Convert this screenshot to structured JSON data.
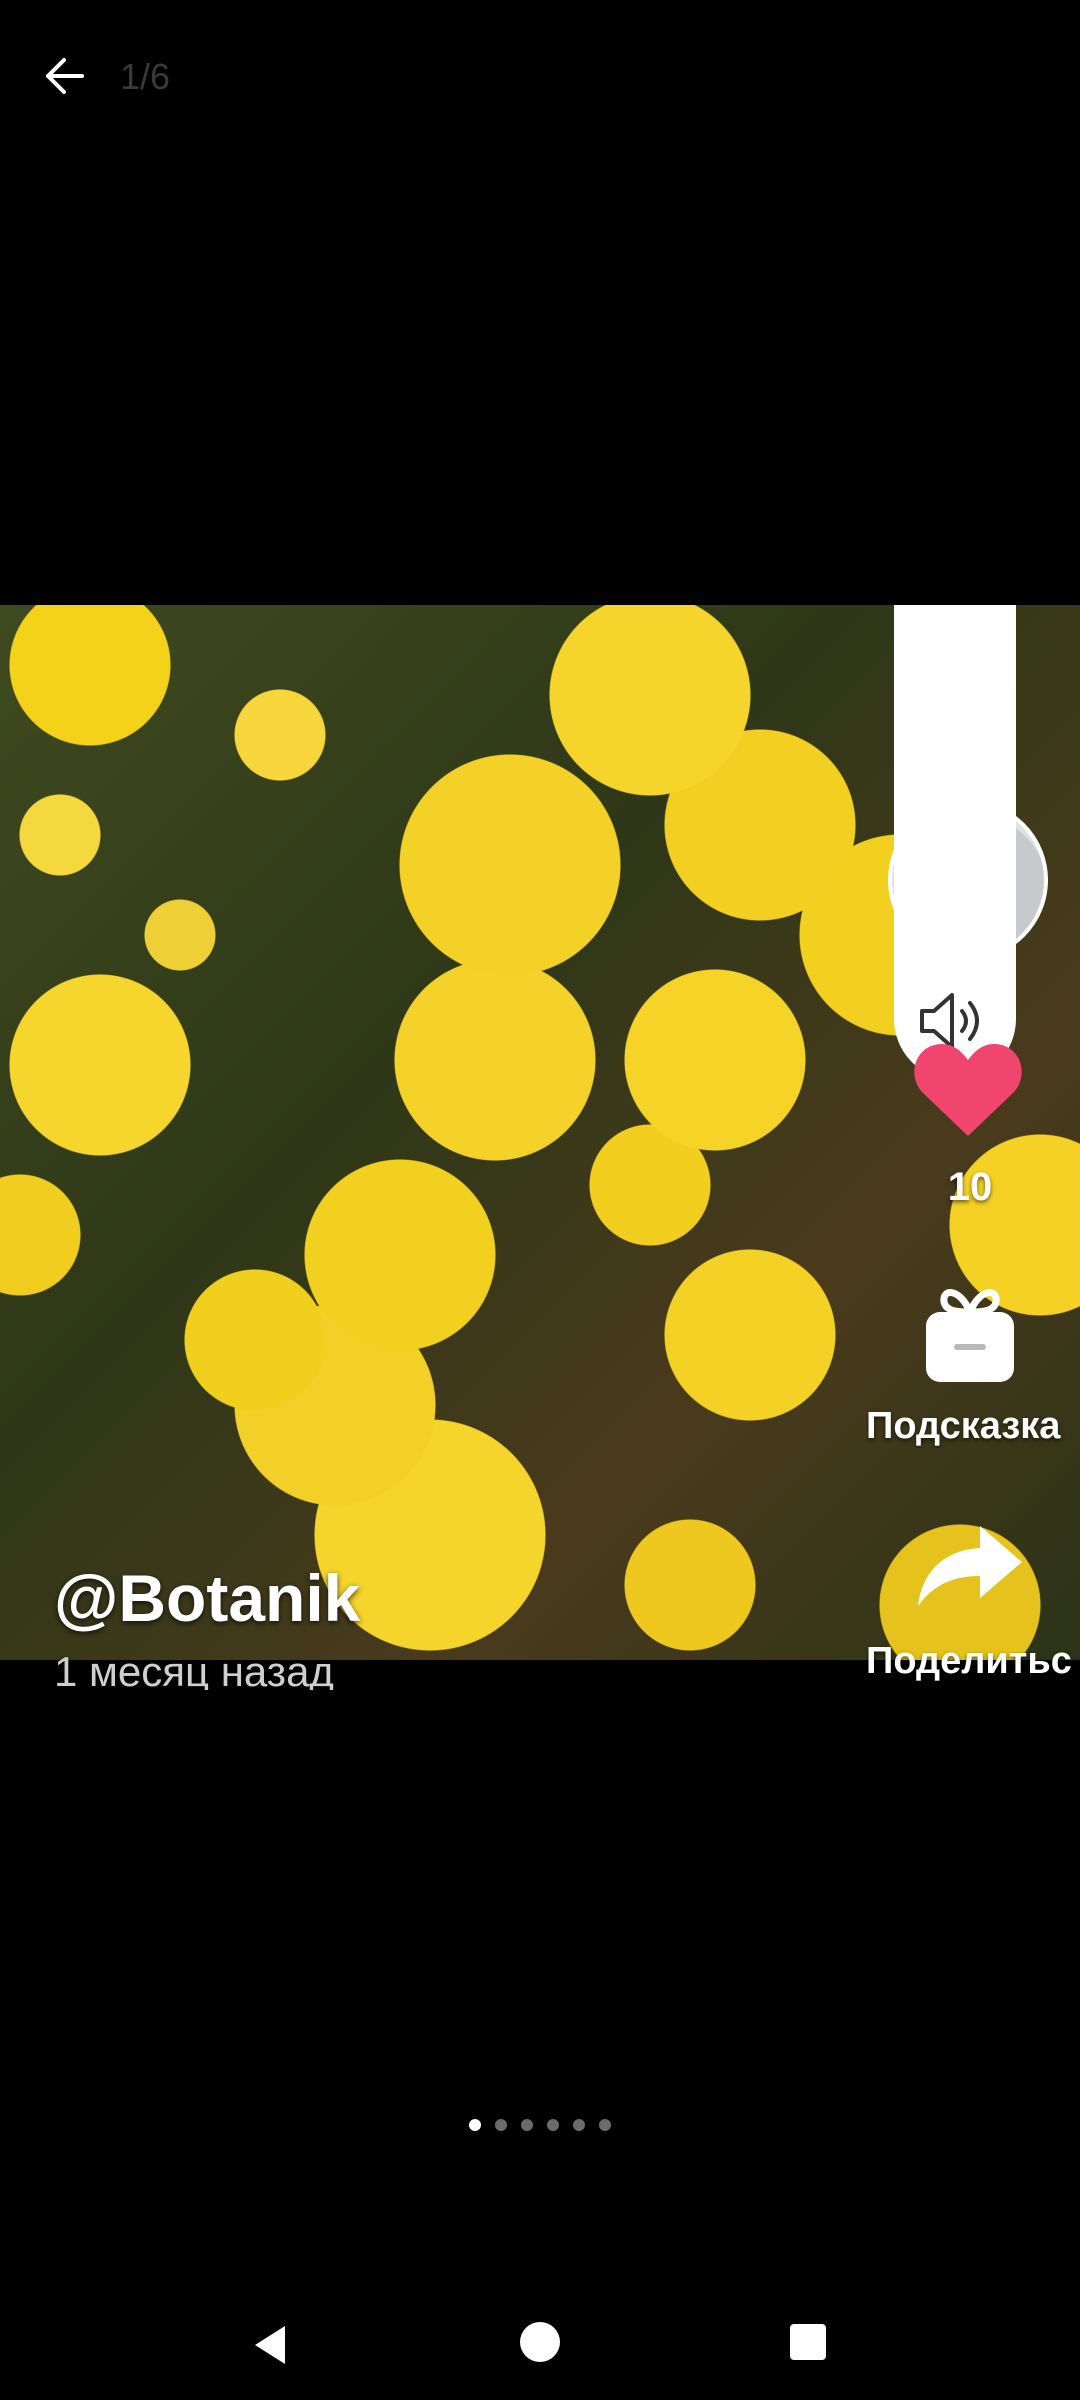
{
  "header": {
    "back_icon": "arrow-left-icon",
    "page_counter": "1/6"
  },
  "post": {
    "author": "@Botanik",
    "time_ago": "1 месяц назад"
  },
  "actions": {
    "like_count": "10",
    "hint_label": "Подсказка",
    "share_label": "Поделитьс"
  },
  "volume": {
    "icon": "speaker-icon",
    "level": 0.0
  },
  "pager": {
    "total": 6,
    "active_index": 0
  },
  "colors": {
    "background": "#000000",
    "like": "#f0456f",
    "page_counter": "#3a3a3a"
  },
  "navigation": {
    "back": "nav-back-icon",
    "home": "nav-home-icon",
    "recents": "nav-recents-icon"
  }
}
